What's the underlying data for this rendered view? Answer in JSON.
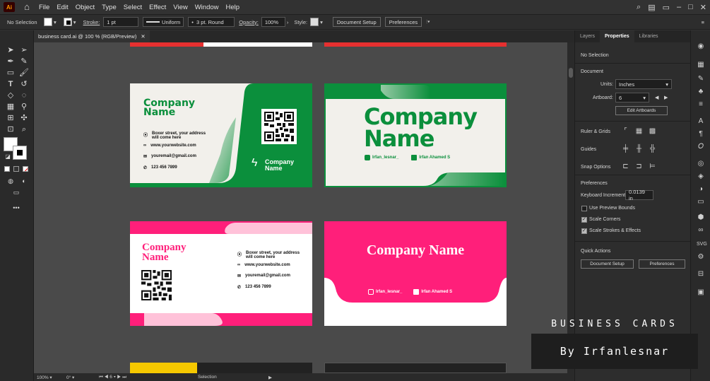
{
  "menubar": {
    "logo": "Ai",
    "items": [
      "File",
      "Edit",
      "Object",
      "Type",
      "Select",
      "Effect",
      "View",
      "Window",
      "Help"
    ]
  },
  "control": {
    "selection": "No Selection",
    "stroke_label": "Stroke:",
    "stroke_weight": "1 pt",
    "stroke_profile": "Uniform",
    "brush": "3 pt. Round",
    "opacity_label": "Opacity:",
    "opacity_value": "100%",
    "style_label": "Style:",
    "document_setup": "Document Setup",
    "preferences": "Preferences"
  },
  "document_tab": {
    "title": "business card.ai @ 100 % (RGB/Preview)"
  },
  "status": {
    "zoom": "100%",
    "rotation": "0°",
    "artboard": "6",
    "tool": "Selection"
  },
  "panel": {
    "tabs": [
      "Layers",
      "Properties",
      "Libraries"
    ],
    "active_tab": "Properties",
    "selection": "No Selection",
    "document_heading": "Document",
    "units_label": "Units:",
    "units_value": "Inches",
    "artboard_label": "Artboard:",
    "artboard_value": "6",
    "edit_artboards": "Edit Artboards",
    "ruler_grids": "Ruler & Grids",
    "guides": "Guides",
    "snap_options": "Snap Options",
    "preferences_heading": "Preferences",
    "keyboard_increment_label": "Keyboard Increment:",
    "keyboard_increment_value": "0.0139 in",
    "use_preview_bounds": "Use Preview Bounds",
    "scale_corners": "Scale Corners",
    "scale_strokes": "Scale Strokes & Effects",
    "quick_actions": "Quick Actions",
    "qa_document_setup": "Document Setup",
    "qa_preferences": "Preferences"
  },
  "cards": {
    "green_front": {
      "company": "Company",
      "company2": "Name",
      "address": "Boxer street, your address",
      "address2": "will come here",
      "website": "www.yourwebsite.com",
      "email": "youremail@gmail.com",
      "phone": "123 456 7899",
      "logo_line1": "Company",
      "logo_line2": "Name"
    },
    "green_back": {
      "company": "Company",
      "company2": "Name",
      "instagram": "Irfan_lesnar_",
      "linkedin": "Irfan Ahamed S"
    },
    "pink_front": {
      "company": "Company",
      "company2": "Name",
      "address": "Boxer street, your address",
      "address2": "will come here",
      "website": "www.yourwebsite.com",
      "email": "youremail@gmail.com",
      "phone": "123 456 7899"
    },
    "pink_back": {
      "company": "Company Name",
      "instagram": "Irfan_lesnar_",
      "linkedin": "Irfan Ahamed S"
    }
  },
  "overlay": {
    "title": "BUSINESS CARDS",
    "author": "By Irfanlesnar"
  },
  "colors": {
    "green": "#0b8f3c",
    "pink": "#ff1f7a",
    "light_pink": "#ffc2d9",
    "cream": "#f2f0eb",
    "yellow": "#f5c800"
  }
}
